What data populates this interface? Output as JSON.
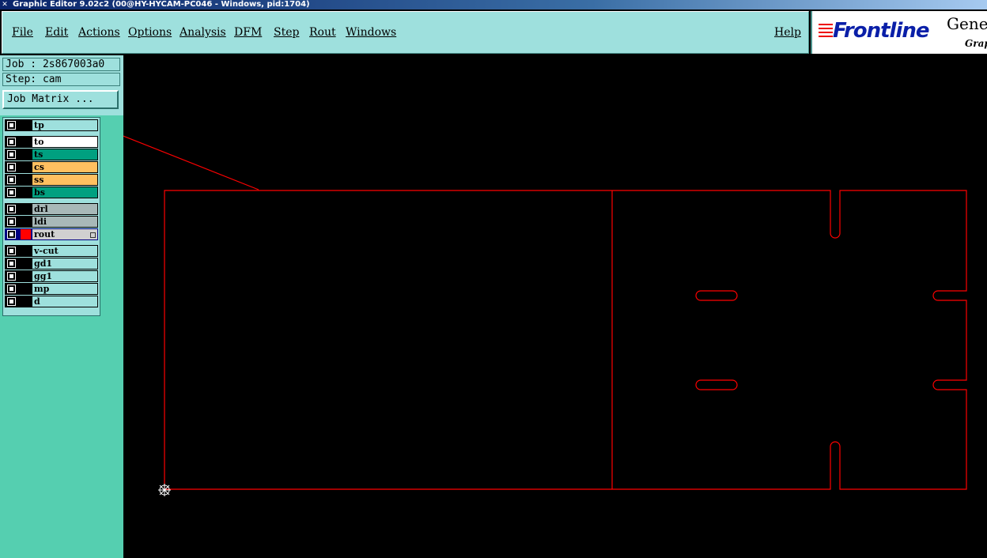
{
  "window": {
    "title": "Graphic Editor 9.02c2 (00@HY-HYCAM-PC046 - Windows, pid:1704)"
  },
  "menu": {
    "file": "File",
    "edit": "Edit",
    "actions": "Actions",
    "options": "Options",
    "analysis": "Analysis",
    "dfm": "DFM",
    "step": "Step",
    "rout": "Rout",
    "windows": "Windows",
    "help": "Help"
  },
  "logo": {
    "brand": "Frontline",
    "suffix": "Gene",
    "sub": "Grap"
  },
  "job": {
    "label": "Job : 2s867003a0",
    "step": "Step: cam",
    "matrix_button": "Job Matrix ..."
  },
  "layers": [
    {
      "name": "tp",
      "color": "#000000",
      "bg": "#9ee0dd"
    },
    {
      "name": "to",
      "color": "#000000",
      "bg": "#ffffff"
    },
    {
      "name": "ts",
      "color": "#000000",
      "bg": "#00a080"
    },
    {
      "name": "cs",
      "color": "#000000",
      "bg": "#ffc060"
    },
    {
      "name": "ss",
      "color": "#000000",
      "bg": "#ffc060"
    },
    {
      "name": "bs",
      "color": "#000000",
      "bg": "#00a080"
    },
    {
      "name": "drl",
      "color": "#000000",
      "bg": "#a8b8b8"
    },
    {
      "name": "ldi",
      "color": "#000000",
      "bg": "#a8b8b8"
    },
    {
      "name": "rout",
      "color": "#ff0000",
      "bg": "#d0d0d0",
      "active": true
    },
    {
      "name": "v-cut",
      "color": "#000000",
      "bg": "#9ee0dd"
    },
    {
      "name": "gd1",
      "color": "#000000",
      "bg": "#9ee0dd"
    },
    {
      "name": "gg1",
      "color": "#000000",
      "bg": "#9ee0dd"
    },
    {
      "name": "mp",
      "color": "#000000",
      "bg": "#9ee0dd"
    },
    {
      "name": "d",
      "color": "#000000",
      "bg": "#9ee0dd"
    }
  ],
  "colors": {
    "panel": "#9ee0dd",
    "pane": "#55cfb0",
    "outline": "#ff0000",
    "background": "#000000"
  }
}
